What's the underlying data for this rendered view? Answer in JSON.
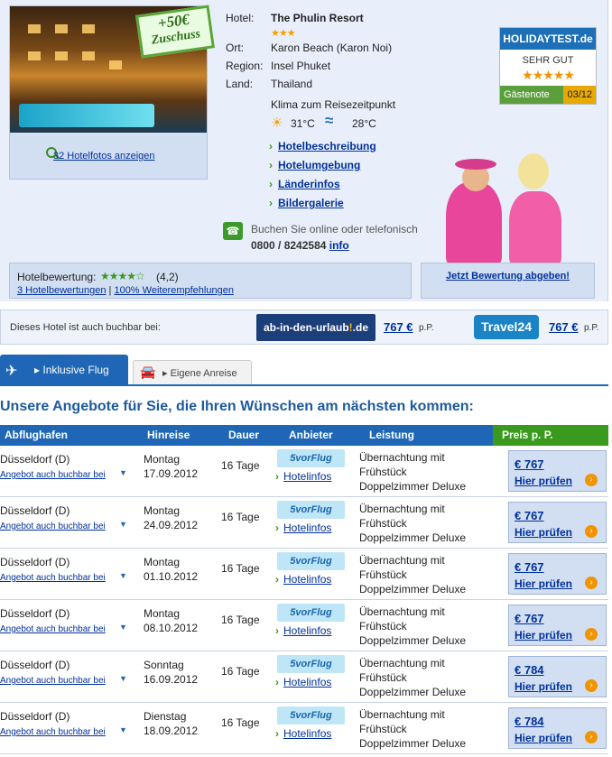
{
  "hotel": {
    "labels": {
      "hotel": "Hotel:",
      "location": "Ort:",
      "region": "Region:",
      "country": "Land:"
    },
    "name": "The Phulin Resort",
    "stars": "★★★",
    "location": "Karon Beach (Karon Noi)",
    "region": "Insel Phuket",
    "country": "Thailand",
    "climate_heading": "Klima zum Reisezeitpunkt",
    "air_temp": "31°C",
    "water_temp": "28°C",
    "photo_badge_line1": "+50€",
    "photo_badge_line2": "Zuschuss",
    "photos_link": "32 Hotelfotos anzeigen",
    "links": [
      "Hotelbeschreibung",
      "Hotelumgebung",
      "Länderinfos",
      "Bildergalerie"
    ],
    "booking_text": "Buchen Sie online oder telefonisch",
    "phone": "0800 / 8242584",
    "phone_info_link": "info"
  },
  "holidaytest": {
    "brand": "HOLIDAYTEST.de",
    "verdict": "SEHR GUT",
    "stars": "★★★★★",
    "grade_label": "Gästenote",
    "date": "03/12"
  },
  "rating": {
    "label": "Hotelbewertung:",
    "stars": "★★★★☆",
    "score": "(4,2)",
    "reviews_link": "3 Hotelbewertungen",
    "separator": "|",
    "recommend_link": "100% Weiterempfehlungen",
    "rate_now": "Jetzt Bewertung abgeben!"
  },
  "also_bookable": {
    "text": "Dieses Hotel ist auch buchbar bei:",
    "provider1_logo": "ab-in-den-urlaub",
    "provider1_logo_ex": "!",
    "provider1_logo_tld": ".de",
    "provider1_price": "767 €",
    "provider2_logo": "Travel24",
    "provider2_price": "767 €",
    "per_person": "p.P."
  },
  "tabs": {
    "flight": "Inklusive Flug",
    "own_travel": "Eigene Anreise"
  },
  "offers": {
    "title": "Unsere Angebote für Sie, die Ihren Wünschen am nächsten kommen:",
    "columns": {
      "departure": "Abflughafen",
      "outbound": "Hinreise",
      "duration": "Dauer",
      "provider": "Anbieter",
      "service": "Leistung",
      "price": "Preis p. P."
    },
    "also_label": "Angebot auch buchbar bei",
    "provider_logo": "5vorFlug",
    "provider_link": "Hotelinfos",
    "check_label": "Hier prüfen",
    "rows": [
      {
        "airport": "Düsseldorf (D)",
        "day": "Montag",
        "date": "17.09.2012",
        "duration": "16 Tage",
        "svc1": "Übernachtung mit",
        "svc2": "Frühstück",
        "svc3": "Doppelzimmer Deluxe",
        "price": "€ 767"
      },
      {
        "airport": "Düsseldorf (D)",
        "day": "Montag",
        "date": "24.09.2012",
        "duration": "16 Tage",
        "svc1": "Übernachtung mit",
        "svc2": "Frühstück",
        "svc3": "Doppelzimmer Deluxe",
        "price": "€ 767"
      },
      {
        "airport": "Düsseldorf (D)",
        "day": "Montag",
        "date": "01.10.2012",
        "duration": "16 Tage",
        "svc1": "Übernachtung mit",
        "svc2": "Frühstück",
        "svc3": "Doppelzimmer Deluxe",
        "price": "€ 767"
      },
      {
        "airport": "Düsseldorf (D)",
        "day": "Montag",
        "date": "08.10.2012",
        "duration": "16 Tage",
        "svc1": "Übernachtung mit",
        "svc2": "Frühstück",
        "svc3": "Doppelzimmer Deluxe",
        "price": "€ 767"
      },
      {
        "airport": "Düsseldorf (D)",
        "day": "Sonntag",
        "date": "16.09.2012",
        "duration": "16 Tage",
        "svc1": "Übernachtung mit",
        "svc2": "Frühstück",
        "svc3": "Doppelzimmer Deluxe",
        "price": "€ 784"
      },
      {
        "airport": "Düsseldorf (D)",
        "day": "Dienstag",
        "date": "18.09.2012",
        "duration": "16 Tage",
        "svc1": "Übernachtung mit",
        "svc2": "Frühstück",
        "svc3": "Doppelzimmer Deluxe",
        "price": "€ 784"
      }
    ]
  }
}
